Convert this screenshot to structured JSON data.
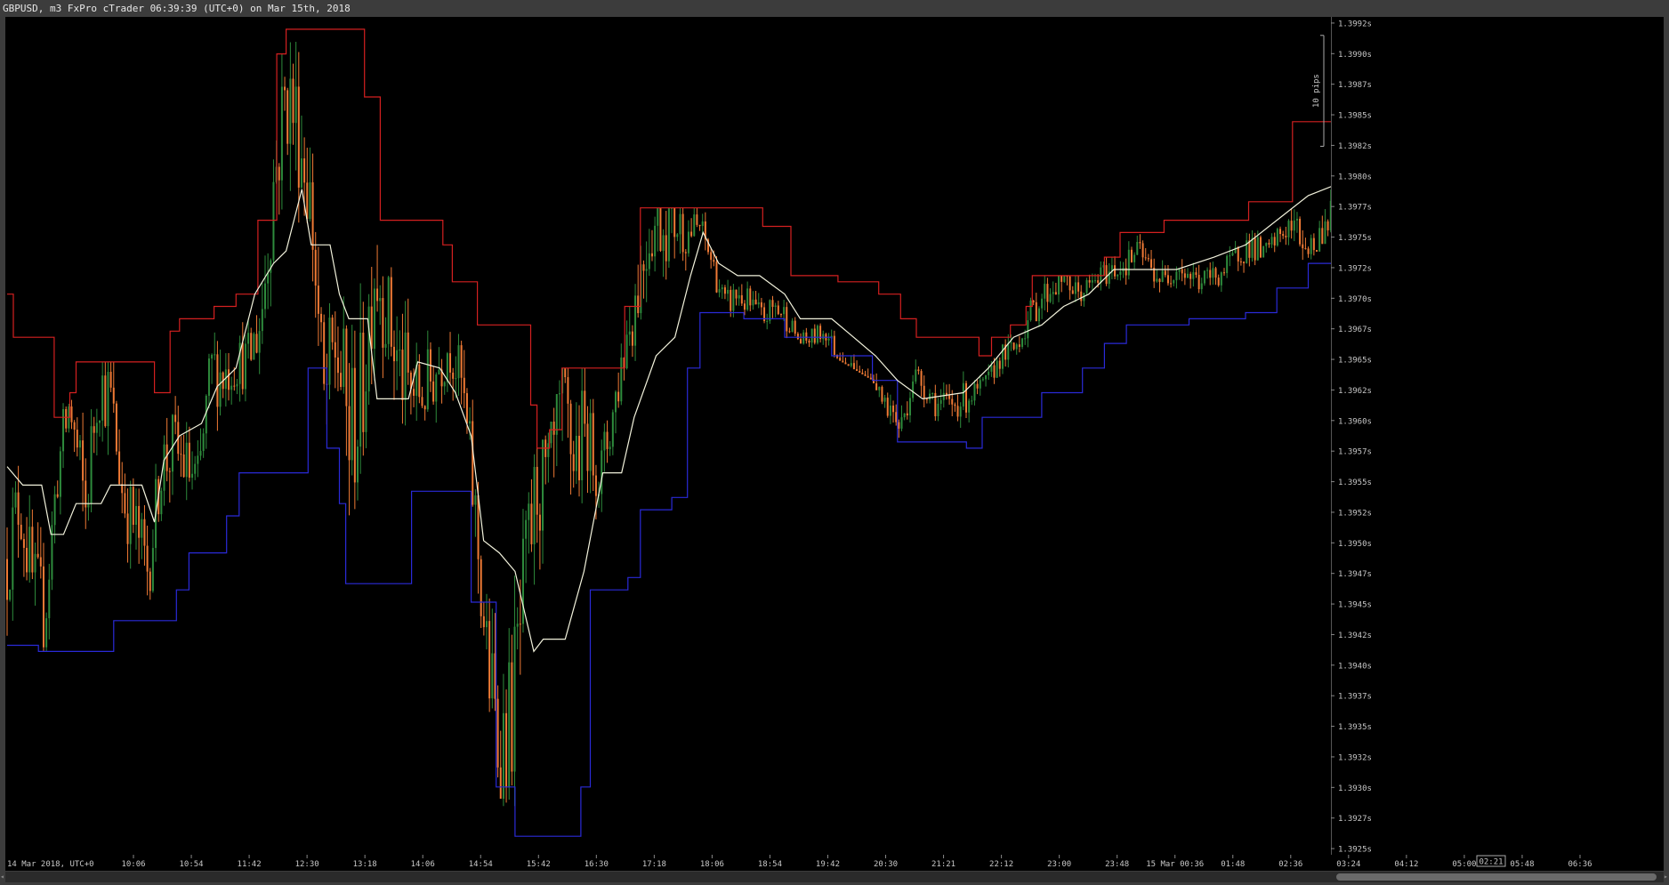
{
  "window": {
    "title": "GBPUSD, m3 FxPro cTrader 06:39:39 (UTC+0) on Mar 15th, 2018"
  },
  "colors": {
    "background": "#000000",
    "frame": "#3c3c3c",
    "axis_text": "#c8c8c8",
    "candle_up": "#2e8b3c",
    "candle_down": "#ef7a35",
    "upper_band": "#d42020",
    "lower_band": "#2a2ad8",
    "middle_line": "#f2f2dc"
  },
  "chart_data": {
    "type": "candlestick",
    "symbol": "GBPUSD",
    "timeframe": "m3",
    "ylim": [
      1.39245,
      1.39925
    ],
    "y_ticks": [
      "1.3992s",
      "1.3990s",
      "1.3987s",
      "1.3985s",
      "1.3982s",
      "1.3980s",
      "1.3977s",
      "1.3975s",
      "1.3972s",
      "1.3970s",
      "1.3967s",
      "1.3965s",
      "1.3962s",
      "1.3960s",
      "1.3957s",
      "1.3955s",
      "1.3952s",
      "1.3950s",
      "1.3947s",
      "1.3945s",
      "1.3942s",
      "1.3940s",
      "1.3937s",
      "1.3935s",
      "1.3932s",
      "1.3930s",
      "1.3927s",
      "1.3925s"
    ],
    "x_ticks": [
      "14 Mar 2018, UTC+0",
      "10:06",
      "10:54",
      "11:42",
      "12:30",
      "13:18",
      "14:06",
      "14:54",
      "15:42",
      "16:30",
      "17:18",
      "18:06",
      "18:54",
      "19:42",
      "20:30",
      "21:21",
      "22:12",
      "23:00",
      "23:48",
      "15 Mar 00:36",
      "01:48",
      "02:36",
      "03:24",
      "04:12",
      "05:00",
      "05:48",
      "06:36"
    ],
    "pip_scale_label": "10 pips",
    "countdown_label": "02:21",
    "close_series": [
      {
        "t": 0.0,
        "v": 1.39485
      },
      {
        "t": 0.008,
        "v": 1.39535
      },
      {
        "t": 0.016,
        "v": 1.39465
      },
      {
        "t": 0.024,
        "v": 1.3944
      },
      {
        "t": 0.032,
        "v": 1.39555
      },
      {
        "t": 0.04,
        "v": 1.3961
      },
      {
        "t": 0.05,
        "v": 1.39525
      },
      {
        "t": 0.058,
        "v": 1.3963
      },
      {
        "t": 0.066,
        "v": 1.39615
      },
      {
        "t": 0.074,
        "v": 1.39535
      },
      {
        "t": 0.082,
        "v": 1.3951
      },
      {
        "t": 0.09,
        "v": 1.39475
      },
      {
        "t": 0.098,
        "v": 1.3956
      },
      {
        "t": 0.106,
        "v": 1.39575
      },
      {
        "t": 0.114,
        "v": 1.3956
      },
      {
        "t": 0.122,
        "v": 1.39545
      },
      {
        "t": 0.13,
        "v": 1.3964
      },
      {
        "t": 0.138,
        "v": 1.39635
      },
      {
        "t": 0.146,
        "v": 1.39645
      },
      {
        "t": 0.154,
        "v": 1.39645
      },
      {
        "t": 0.162,
        "v": 1.3968
      },
      {
        "t": 0.17,
        "v": 1.3979
      },
      {
        "t": 0.178,
        "v": 1.39865
      },
      {
        "t": 0.186,
        "v": 1.39835
      },
      {
        "t": 0.194,
        "v": 1.3977
      },
      {
        "t": 0.202,
        "v": 1.3961
      },
      {
        "t": 0.21,
        "v": 1.3966
      },
      {
        "t": 0.218,
        "v": 1.39585
      },
      {
        "t": 0.226,
        "v": 1.3961
      },
      {
        "t": 0.234,
        "v": 1.3973
      },
      {
        "t": 0.242,
        "v": 1.39685
      },
      {
        "t": 0.25,
        "v": 1.3964
      },
      {
        "t": 0.258,
        "v": 1.3962
      },
      {
        "t": 0.266,
        "v": 1.3962
      },
      {
        "t": 0.274,
        "v": 1.3964
      },
      {
        "t": 0.282,
        "v": 1.3966
      },
      {
        "t": 0.29,
        "v": 1.39625
      },
      {
        "t": 0.298,
        "v": 1.3953
      },
      {
        "t": 0.306,
        "v": 1.39405
      },
      {
        "t": 0.314,
        "v": 1.3933
      },
      {
        "t": 0.322,
        "v": 1.3936
      },
      {
        "t": 0.33,
        "v": 1.3946
      },
      {
        "t": 0.338,
        "v": 1.39545
      },
      {
        "t": 0.346,
        "v": 1.39545
      },
      {
        "t": 0.354,
        "v": 1.396
      },
      {
        "t": 0.362,
        "v": 1.3957
      },
      {
        "t": 0.37,
        "v": 1.3959
      },
      {
        "t": 0.378,
        "v": 1.3955
      },
      {
        "t": 0.386,
        "v": 1.396
      },
      {
        "t": 0.394,
        "v": 1.3966
      },
      {
        "t": 0.402,
        "v": 1.39705
      },
      {
        "t": 0.41,
        "v": 1.39755
      },
      {
        "t": 0.418,
        "v": 1.3976
      },
      {
        "t": 0.426,
        "v": 1.3976
      },
      {
        "t": 0.434,
        "v": 1.3975
      },
      {
        "t": 0.442,
        "v": 1.39755
      },
      {
        "t": 0.45,
        "v": 1.39725
      },
      {
        "t": 0.458,
        "v": 1.3969
      },
      {
        "t": 0.466,
        "v": 1.397
      },
      {
        "t": 0.474,
        "v": 1.3969
      },
      {
        "t": 0.482,
        "v": 1.3968
      },
      {
        "t": 0.49,
        "v": 1.3969
      },
      {
        "t": 0.498,
        "v": 1.3968
      },
      {
        "t": 0.506,
        "v": 1.3966
      },
      {
        "t": 0.514,
        "v": 1.39665
      },
      {
        "t": 0.522,
        "v": 1.3967
      },
      {
        "t": 0.53,
        "v": 1.3965
      },
      {
        "t": 0.538,
        "v": 1.3964
      },
      {
        "t": 0.546,
        "v": 1.39625
      },
      {
        "t": 0.554,
        "v": 1.39615
      },
      {
        "t": 0.562,
        "v": 1.3961
      },
      {
        "t": 0.57,
        "v": 1.3959
      },
      {
        "t": 0.578,
        "v": 1.39635
      },
      {
        "t": 0.586,
        "v": 1.39625
      },
      {
        "t": 0.594,
        "v": 1.3961
      },
      {
        "t": 0.602,
        "v": 1.3961
      },
      {
        "t": 0.61,
        "v": 1.39615
      },
      {
        "t": 0.618,
        "v": 1.3962
      },
      {
        "t": 0.626,
        "v": 1.3963
      },
      {
        "t": 0.634,
        "v": 1.3965
      },
      {
        "t": 0.642,
        "v": 1.39655
      },
      {
        "t": 0.65,
        "v": 1.39675
      },
      {
        "t": 0.658,
        "v": 1.39695
      },
      {
        "t": 0.666,
        "v": 1.39705
      },
      {
        "t": 0.674,
        "v": 1.39715
      },
      {
        "t": 0.682,
        "v": 1.397
      },
      {
        "t": 0.69,
        "v": 1.39705
      },
      {
        "t": 0.698,
        "v": 1.39715
      },
      {
        "t": 0.706,
        "v": 1.3972
      },
      {
        "t": 0.714,
        "v": 1.39725
      },
      {
        "t": 0.722,
        "v": 1.39735
      },
      {
        "t": 0.73,
        "v": 1.3972
      },
      {
        "t": 0.738,
        "v": 1.3971
      },
      {
        "t": 0.746,
        "v": 1.39725
      },
      {
        "t": 0.754,
        "v": 1.39715
      },
      {
        "t": 0.762,
        "v": 1.3971
      },
      {
        "t": 0.77,
        "v": 1.39715
      },
      {
        "t": 0.778,
        "v": 1.3972
      },
      {
        "t": 0.786,
        "v": 1.39735
      },
      {
        "t": 0.794,
        "v": 1.3974
      },
      {
        "t": 0.802,
        "v": 1.3973
      },
      {
        "t": 0.81,
        "v": 1.39745
      },
      {
        "t": 0.818,
        "v": 1.39755
      },
      {
        "t": 0.826,
        "v": 1.39745
      },
      {
        "t": 0.834,
        "v": 1.39735
      },
      {
        "t": 0.842,
        "v": 1.3976
      },
      {
        "t": 0.85,
        "v": 1.3978
      },
      {
        "t": 0.858,
        "v": 1.39805
      },
      {
        "t": 0.866,
        "v": 1.39815
      },
      {
        "t": 0.874,
        "v": 1.398
      },
      {
        "t": 0.882,
        "v": 1.3981
      },
      {
        "t": 0.89,
        "v": 1.39825
      },
      {
        "t": 0.898,
        "v": 1.3983
      },
      {
        "t": 0.906,
        "v": 1.3982
      },
      {
        "t": 0.914,
        "v": 1.3983
      },
      {
        "t": 0.922,
        "v": 1.398
      },
      {
        "t": 0.93,
        "v": 1.39785
      },
      {
        "t": 0.938,
        "v": 1.3981
      },
      {
        "t": 0.946,
        "v": 1.3979
      },
      {
        "t": 0.954,
        "v": 1.3973
      },
      {
        "t": 0.962,
        "v": 1.3971
      },
      {
        "t": 0.97,
        "v": 1.397
      },
      {
        "t": 0.978,
        "v": 1.39715
      },
      {
        "t": 0.986,
        "v": 1.3973
      },
      {
        "t": 0.994,
        "v": 1.39755
      },
      {
        "t": 1.0,
        "v": 1.3978
      }
    ],
    "upper_band": [
      {
        "t": 0.0,
        "v": 1.397
      },
      {
        "t": 0.004,
        "v": 1.39665
      },
      {
        "t": 0.024,
        "v": 1.39665
      },
      {
        "t": 0.03,
        "v": 1.396
      },
      {
        "t": 0.04,
        "v": 1.3962
      },
      {
        "t": 0.044,
        "v": 1.39645
      },
      {
        "t": 0.09,
        "v": 1.39645
      },
      {
        "t": 0.094,
        "v": 1.3962
      },
      {
        "t": 0.104,
        "v": 1.3967
      },
      {
        "t": 0.11,
        "v": 1.3968
      },
      {
        "t": 0.126,
        "v": 1.3968
      },
      {
        "t": 0.132,
        "v": 1.3969
      },
      {
        "t": 0.146,
        "v": 1.397
      },
      {
        "t": 0.16,
        "v": 1.3976
      },
      {
        "t": 0.172,
        "v": 1.39895
      },
      {
        "t": 0.178,
        "v": 1.39915
      },
      {
        "t": 0.224,
        "v": 1.39915
      },
      {
        "t": 0.228,
        "v": 1.3986
      },
      {
        "t": 0.234,
        "v": 1.3986
      },
      {
        "t": 0.238,
        "v": 1.3976
      },
      {
        "t": 0.27,
        "v": 1.3976
      },
      {
        "t": 0.278,
        "v": 1.3974
      },
      {
        "t": 0.284,
        "v": 1.3971
      },
      {
        "t": 0.296,
        "v": 1.3971
      },
      {
        "t": 0.3,
        "v": 1.39675
      },
      {
        "t": 0.328,
        "v": 1.39675
      },
      {
        "t": 0.334,
        "v": 1.3961
      },
      {
        "t": 0.338,
        "v": 1.39575
      },
      {
        "t": 0.346,
        "v": 1.3959
      },
      {
        "t": 0.354,
        "v": 1.3964
      },
      {
        "t": 0.388,
        "v": 1.3964
      },
      {
        "t": 0.394,
        "v": 1.3969
      },
      {
        "t": 0.404,
        "v": 1.3977
      },
      {
        "t": 0.476,
        "v": 1.3977
      },
      {
        "t": 0.482,
        "v": 1.39755
      },
      {
        "t": 0.496,
        "v": 1.39755
      },
      {
        "t": 0.5,
        "v": 1.39715
      },
      {
        "t": 0.53,
        "v": 1.3971
      },
      {
        "t": 0.556,
        "v": 1.397
      },
      {
        "t": 0.57,
        "v": 1.3968
      },
      {
        "t": 0.58,
        "v": 1.39665
      },
      {
        "t": 0.612,
        "v": 1.39665
      },
      {
        "t": 0.62,
        "v": 1.3965
      },
      {
        "t": 0.628,
        "v": 1.39665
      },
      {
        "t": 0.64,
        "v": 1.39675
      },
      {
        "t": 0.65,
        "v": 1.3969
      },
      {
        "t": 0.654,
        "v": 1.39715
      },
      {
        "t": 0.69,
        "v": 1.39715
      },
      {
        "t": 0.7,
        "v": 1.3973
      },
      {
        "t": 0.71,
        "v": 1.3975
      },
      {
        "t": 0.73,
        "v": 1.3975
      },
      {
        "t": 0.738,
        "v": 1.3976
      },
      {
        "t": 0.786,
        "v": 1.3976
      },
      {
        "t": 0.792,
        "v": 1.39775
      },
      {
        "t": 0.814,
        "v": 1.39775
      },
      {
        "t": 0.82,
        "v": 1.3984
      },
      {
        "t": 0.848,
        "v": 1.3984
      },
      {
        "t": 0.856,
        "v": 1.39855
      },
      {
        "t": 0.9,
        "v": 1.39855
      },
      {
        "t": 0.93,
        "v": 1.3985
      },
      {
        "t": 0.98,
        "v": 1.39845
      },
      {
        "t": 1.0,
        "v": 1.39795
      }
    ],
    "lower_band": [
      {
        "t": 0.0,
        "v": 1.39415
      },
      {
        "t": 0.02,
        "v": 1.3941
      },
      {
        "t": 0.064,
        "v": 1.3941
      },
      {
        "t": 0.068,
        "v": 1.39435
      },
      {
        "t": 0.104,
        "v": 1.39435
      },
      {
        "t": 0.108,
        "v": 1.3946
      },
      {
        "t": 0.116,
        "v": 1.3949
      },
      {
        "t": 0.136,
        "v": 1.3949
      },
      {
        "t": 0.14,
        "v": 1.3952
      },
      {
        "t": 0.148,
        "v": 1.39555
      },
      {
        "t": 0.188,
        "v": 1.39555
      },
      {
        "t": 0.192,
        "v": 1.3964
      },
      {
        "t": 0.204,
        "v": 1.39575
      },
      {
        "t": 0.212,
        "v": 1.3953
      },
      {
        "t": 0.216,
        "v": 1.39465
      },
      {
        "t": 0.254,
        "v": 1.39465
      },
      {
        "t": 0.258,
        "v": 1.3954
      },
      {
        "t": 0.286,
        "v": 1.3954
      },
      {
        "t": 0.296,
        "v": 1.3945
      },
      {
        "t": 0.312,
        "v": 1.393
      },
      {
        "t": 0.324,
        "v": 1.3926
      },
      {
        "t": 0.362,
        "v": 1.3926
      },
      {
        "t": 0.366,
        "v": 1.393
      },
      {
        "t": 0.372,
        "v": 1.3946
      },
      {
        "t": 0.396,
        "v": 1.3947
      },
      {
        "t": 0.404,
        "v": 1.39525
      },
      {
        "t": 0.424,
        "v": 1.39535
      },
      {
        "t": 0.434,
        "v": 1.3964
      },
      {
        "t": 0.442,
        "v": 1.39685
      },
      {
        "t": 0.47,
        "v": 1.3968
      },
      {
        "t": 0.496,
        "v": 1.39665
      },
      {
        "t": 0.526,
        "v": 1.3965
      },
      {
        "t": 0.552,
        "v": 1.3963
      },
      {
        "t": 0.568,
        "v": 1.3958
      },
      {
        "t": 0.612,
        "v": 1.39575
      },
      {
        "t": 0.622,
        "v": 1.396
      },
      {
        "t": 0.66,
        "v": 1.3962
      },
      {
        "t": 0.686,
        "v": 1.3964
      },
      {
        "t": 0.7,
        "v": 1.3966
      },
      {
        "t": 0.714,
        "v": 1.39675
      },
      {
        "t": 0.754,
        "v": 1.3968
      },
      {
        "t": 0.79,
        "v": 1.39685
      },
      {
        "t": 0.81,
        "v": 1.39705
      },
      {
        "t": 0.83,
        "v": 1.39725
      },
      {
        "t": 0.85,
        "v": 1.3976
      },
      {
        "t": 0.866,
        "v": 1.39795
      },
      {
        "t": 0.874,
        "v": 1.398
      },
      {
        "t": 0.91,
        "v": 1.3979
      },
      {
        "t": 0.946,
        "v": 1.3969
      },
      {
        "t": 0.958,
        "v": 1.39685
      },
      {
        "t": 1.0,
        "v": 1.39685
      }
    ],
    "middle_line": [
      {
        "t": 0.0,
        "v": 1.3956
      },
      {
        "t": 0.01,
        "v": 1.39545
      },
      {
        "t": 0.022,
        "v": 1.39545
      },
      {
        "t": 0.028,
        "v": 1.39505
      },
      {
        "t": 0.036,
        "v": 1.39505
      },
      {
        "t": 0.044,
        "v": 1.3953
      },
      {
        "t": 0.06,
        "v": 1.3953
      },
      {
        "t": 0.066,
        "v": 1.39545
      },
      {
        "t": 0.086,
        "v": 1.39545
      },
      {
        "t": 0.094,
        "v": 1.39515
      },
      {
        "t": 0.1,
        "v": 1.39565
      },
      {
        "t": 0.11,
        "v": 1.39585
      },
      {
        "t": 0.124,
        "v": 1.39595
      },
      {
        "t": 0.134,
        "v": 1.39625
      },
      {
        "t": 0.146,
        "v": 1.3964
      },
      {
        "t": 0.158,
        "v": 1.397
      },
      {
        "t": 0.17,
        "v": 1.39725
      },
      {
        "t": 0.178,
        "v": 1.39735
      },
      {
        "t": 0.188,
        "v": 1.39785
      },
      {
        "t": 0.194,
        "v": 1.3974
      },
      {
        "t": 0.206,
        "v": 1.3974
      },
      {
        "t": 0.212,
        "v": 1.397
      },
      {
        "t": 0.218,
        "v": 1.3968
      },
      {
        "t": 0.23,
        "v": 1.3968
      },
      {
        "t": 0.236,
        "v": 1.39615
      },
      {
        "t": 0.256,
        "v": 1.39615
      },
      {
        "t": 0.262,
        "v": 1.39645
      },
      {
        "t": 0.276,
        "v": 1.3964
      },
      {
        "t": 0.286,
        "v": 1.3962
      },
      {
        "t": 0.296,
        "v": 1.39585
      },
      {
        "t": 0.304,
        "v": 1.395
      },
      {
        "t": 0.314,
        "v": 1.3949
      },
      {
        "t": 0.324,
        "v": 1.39475
      },
      {
        "t": 0.336,
        "v": 1.3941
      },
      {
        "t": 0.342,
        "v": 1.3942
      },
      {
        "t": 0.356,
        "v": 1.3942
      },
      {
        "t": 0.368,
        "v": 1.39475
      },
      {
        "t": 0.38,
        "v": 1.39555
      },
      {
        "t": 0.392,
        "v": 1.39555
      },
      {
        "t": 0.4,
        "v": 1.396
      },
      {
        "t": 0.414,
        "v": 1.3965
      },
      {
        "t": 0.426,
        "v": 1.39665
      },
      {
        "t": 0.436,
        "v": 1.39715
      },
      {
        "t": 0.444,
        "v": 1.3975
      },
      {
        "t": 0.454,
        "v": 1.39725
      },
      {
        "t": 0.466,
        "v": 1.39715
      },
      {
        "t": 0.48,
        "v": 1.39715
      },
      {
        "t": 0.496,
        "v": 1.397
      },
      {
        "t": 0.506,
        "v": 1.3968
      },
      {
        "t": 0.526,
        "v": 1.3968
      },
      {
        "t": 0.54,
        "v": 1.39665
      },
      {
        "t": 0.554,
        "v": 1.3965
      },
      {
        "t": 0.568,
        "v": 1.3963
      },
      {
        "t": 0.584,
        "v": 1.39615
      },
      {
        "t": 0.61,
        "v": 1.3962
      },
      {
        "t": 0.626,
        "v": 1.3964
      },
      {
        "t": 0.642,
        "v": 1.39665
      },
      {
        "t": 0.66,
        "v": 1.39675
      },
      {
        "t": 0.674,
        "v": 1.3969
      },
      {
        "t": 0.69,
        "v": 1.397
      },
      {
        "t": 0.706,
        "v": 1.3972
      },
      {
        "t": 0.726,
        "v": 1.3972
      },
      {
        "t": 0.746,
        "v": 1.3972
      },
      {
        "t": 0.77,
        "v": 1.3973
      },
      {
        "t": 0.79,
        "v": 1.3974
      },
      {
        "t": 0.81,
        "v": 1.3976
      },
      {
        "t": 0.83,
        "v": 1.3978
      },
      {
        "t": 0.85,
        "v": 1.3979
      },
      {
        "t": 0.866,
        "v": 1.39815
      },
      {
        "t": 0.882,
        "v": 1.3983
      },
      {
        "t": 0.9,
        "v": 1.39825
      },
      {
        "t": 0.92,
        "v": 1.3982
      },
      {
        "t": 0.934,
        "v": 1.3979
      },
      {
        "t": 0.946,
        "v": 1.39775
      },
      {
        "t": 0.962,
        "v": 1.3976
      },
      {
        "t": 0.984,
        "v": 1.3976
      },
      {
        "t": 1.0,
        "v": 1.3974
      }
    ]
  }
}
